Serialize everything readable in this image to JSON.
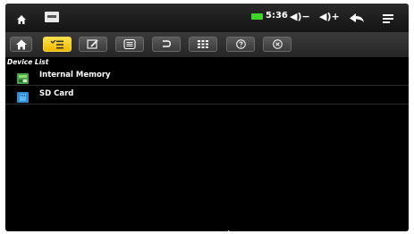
{
  "status_bar": {
    "time": "5:36",
    "volume_down_label": "◀)−",
    "volume_up_label": "◀)+",
    "icons": [
      "home-icon",
      "hdmi-icon",
      "battery-icon",
      "volume-down-icon",
      "volume-up-icon",
      "back-icon",
      "menu-icon"
    ],
    "battery_color": "#3fd42a"
  },
  "toolbar": {
    "buttons": [
      {
        "icon": "home-icon"
      },
      {
        "icon": "list-icon",
        "active": true
      },
      {
        "icon": "edit-icon"
      },
      {
        "icon": "document-icon"
      },
      {
        "icon": "undo-icon"
      },
      {
        "icon": "grid-icon"
      },
      {
        "icon": "help-icon"
      },
      {
        "icon": "close-icon"
      }
    ],
    "active_color": "#f5c400"
  },
  "device_list": {
    "header": "Device List",
    "items": [
      {
        "label": "Internal Memory",
        "icon": "internal-memory-icon"
      },
      {
        "label": "SD Card",
        "icon": "sd-card-icon"
      }
    ]
  }
}
